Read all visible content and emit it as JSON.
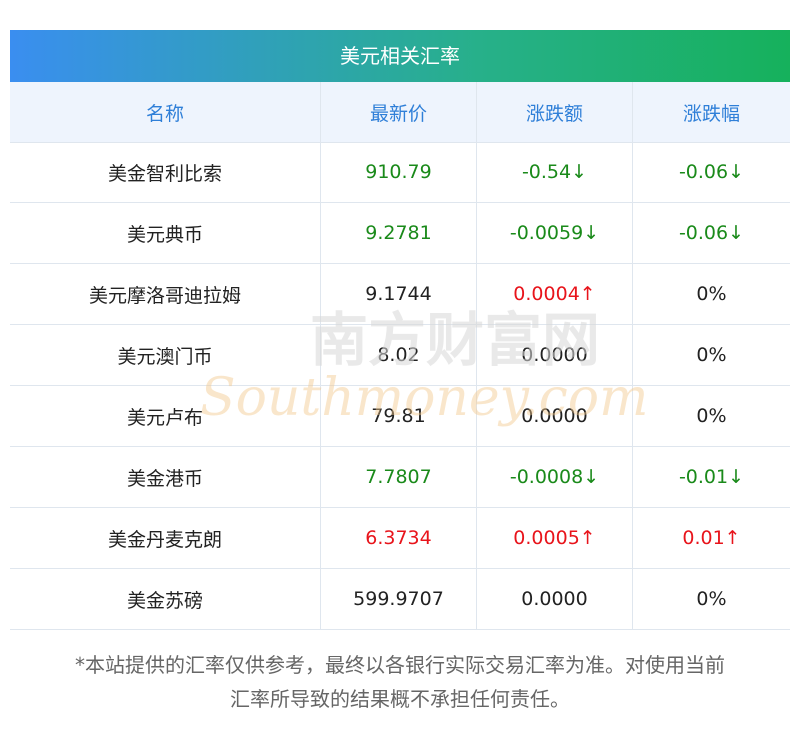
{
  "title": "美元相关汇率",
  "headers": [
    "名称",
    "最新价",
    "涨跌额",
    "涨跌幅"
  ],
  "rows": [
    {
      "name": "美金智利比索",
      "price": "910.79",
      "change": "-0.54↓",
      "pct": "-0.06↓",
      "color": "green",
      "pct_color": "green"
    },
    {
      "name": "美元典币",
      "price": "9.2781",
      "change": "-0.0059↓",
      "pct": "-0.06↓",
      "color": "green",
      "pct_color": "green"
    },
    {
      "name": "美元摩洛哥迪拉姆",
      "price": "9.1744",
      "change": "0.0004↑",
      "pct": "0%",
      "color": "black",
      "change_color": "red",
      "pct_color": "black"
    },
    {
      "name": "美元澳门币",
      "price": "8.02",
      "change": "0.0000",
      "pct": "0%",
      "color": "black",
      "pct_color": "black"
    },
    {
      "name": "美元卢布",
      "price": "79.81",
      "change": "0.0000",
      "pct": "0%",
      "color": "black",
      "pct_color": "black"
    },
    {
      "name": "美金港币",
      "price": "7.7807",
      "change": "-0.0008↓",
      "pct": "-0.01↓",
      "color": "green",
      "pct_color": "green"
    },
    {
      "name": "美金丹麦克朗",
      "price": "6.3734",
      "change": "0.0005↑",
      "pct": "0.01↑",
      "color": "red",
      "pct_color": "red"
    },
    {
      "name": "美金苏磅",
      "price": "599.9707",
      "change": "0.0000",
      "pct": "0%",
      "color": "black",
      "pct_color": "black"
    }
  ],
  "watermark": {
    "cn": "南方财富网",
    "en": "Southmoney.com"
  },
  "note": [
    "*本站提供的汇率仅供参考，最终以各银行实际交易汇率为准。对使用当前",
    "汇率所导致的结果概不承担任何责任。"
  ],
  "colors": {
    "accent": "#2f7fd8",
    "up": "#e8141b",
    "down": "#1a8a1a"
  }
}
